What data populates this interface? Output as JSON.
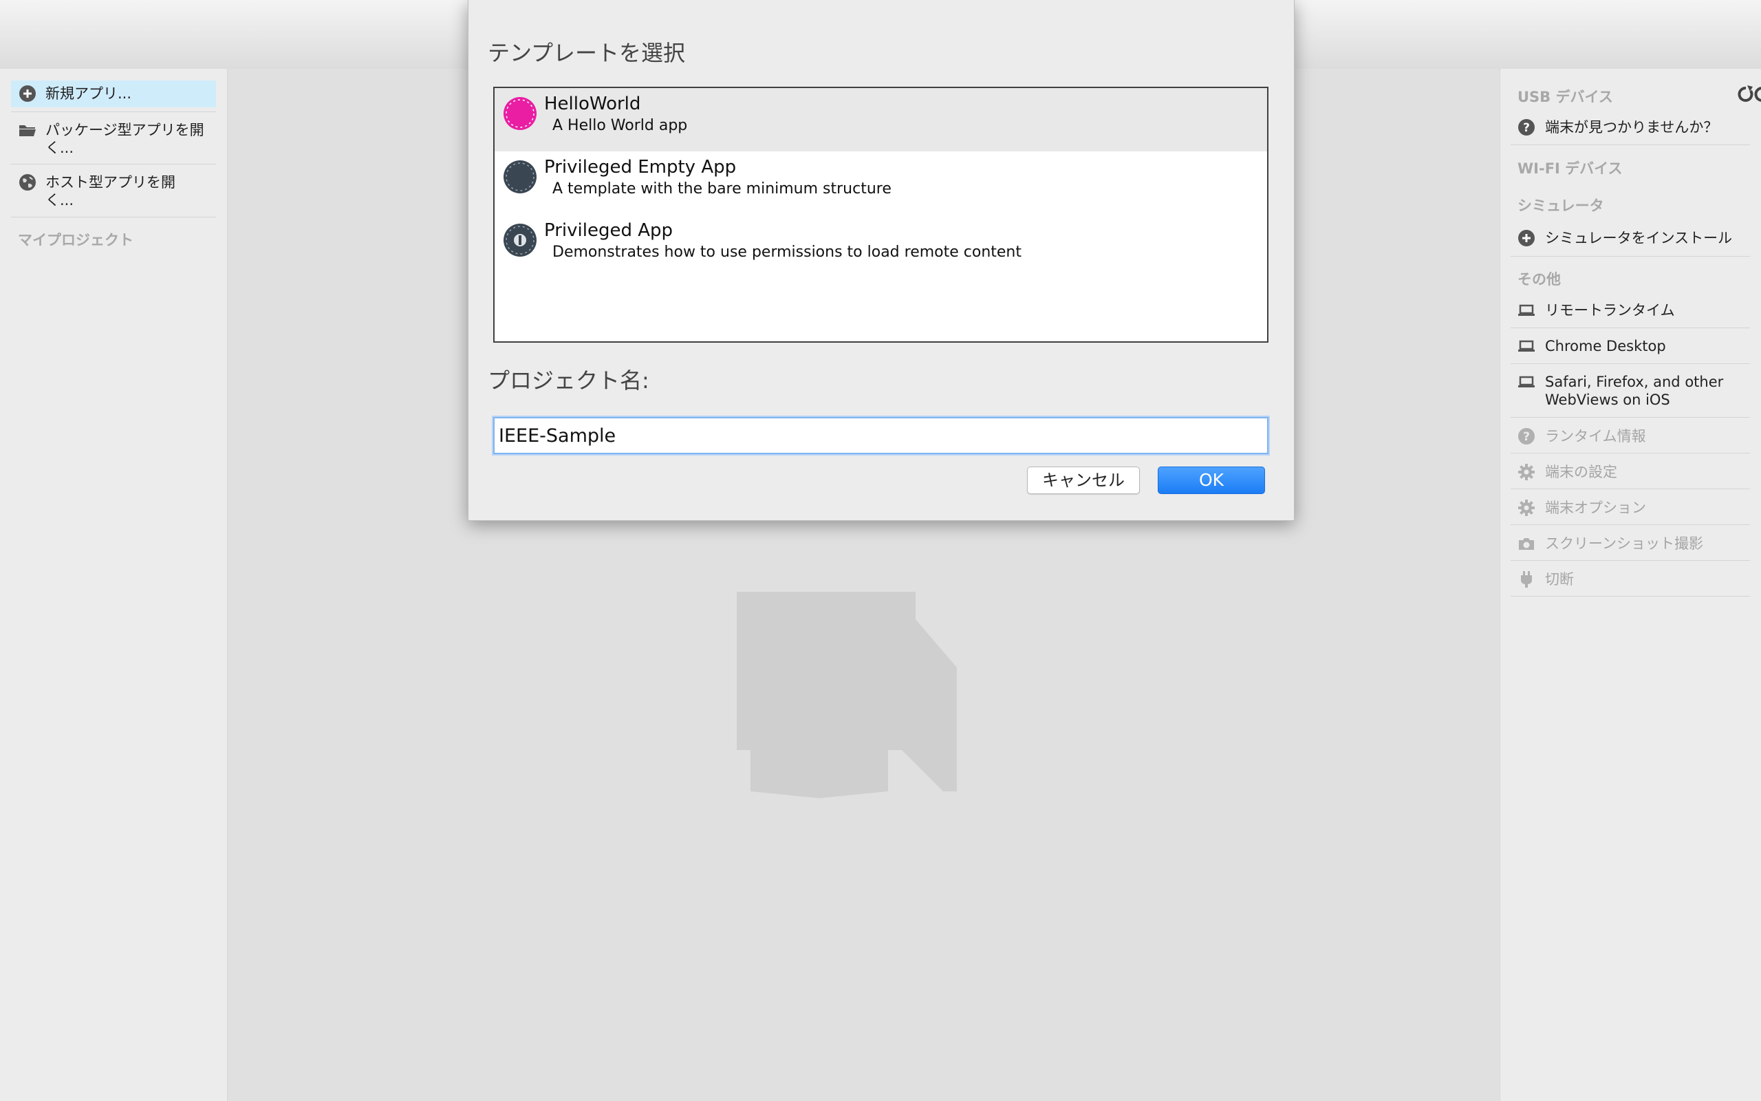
{
  "left_panel": {
    "items": [
      {
        "label": "新規アプリ...",
        "icon": "plus-circle-icon"
      },
      {
        "label": "パッケージ型アプリを開く...",
        "icon": "folder-icon"
      },
      {
        "label": "ホスト型アプリを開く...",
        "icon": "globe-icon"
      }
    ],
    "section_my_projects": "マイプロジェクト"
  },
  "right_panel": {
    "usb_heading": "USB デバイス",
    "wifi_heading": "WI-FI デバイス",
    "simulator_heading": "シミュレータ",
    "other_heading": "その他",
    "items": {
      "device_not_found": "端末が見つかりませんか？",
      "install_simulator": "シミュレータをインストール",
      "remote_runtime": "リモートランタイム",
      "chrome_desktop": "Chrome Desktop",
      "safari_line1": "Safari, Firefox, and other",
      "safari_line2": "WebViews on iOS",
      "runtime_info": "ランタイム情報",
      "device_settings": "端末の設定",
      "device_options": "端末オプション",
      "screenshot": "スクリーンショット撮影",
      "disconnect": "切断"
    }
  },
  "dialog": {
    "title": "テンプレートを選択",
    "templates": [
      {
        "name": "HelloWorld",
        "description": "A Hello World app",
        "icon_color": "#e91ea3"
      },
      {
        "name": "Privileged Empty App",
        "description": "A template with the bare minimum structure",
        "icon_color": "#3a4652"
      },
      {
        "name": "Privileged App",
        "description": "Demonstrates how to use permissions to load remote content",
        "icon_color": "#3a4652"
      }
    ],
    "project_name_label": "プロジェクト名:",
    "project_name_value": "IEEE-Sample",
    "cancel_label": "キャンセル",
    "ok_label": "OK"
  },
  "colors": {
    "selected_highlight": "#cfecfb",
    "ok_button": "#1b7cf5",
    "helloworld_icon": "#e91ea3"
  }
}
